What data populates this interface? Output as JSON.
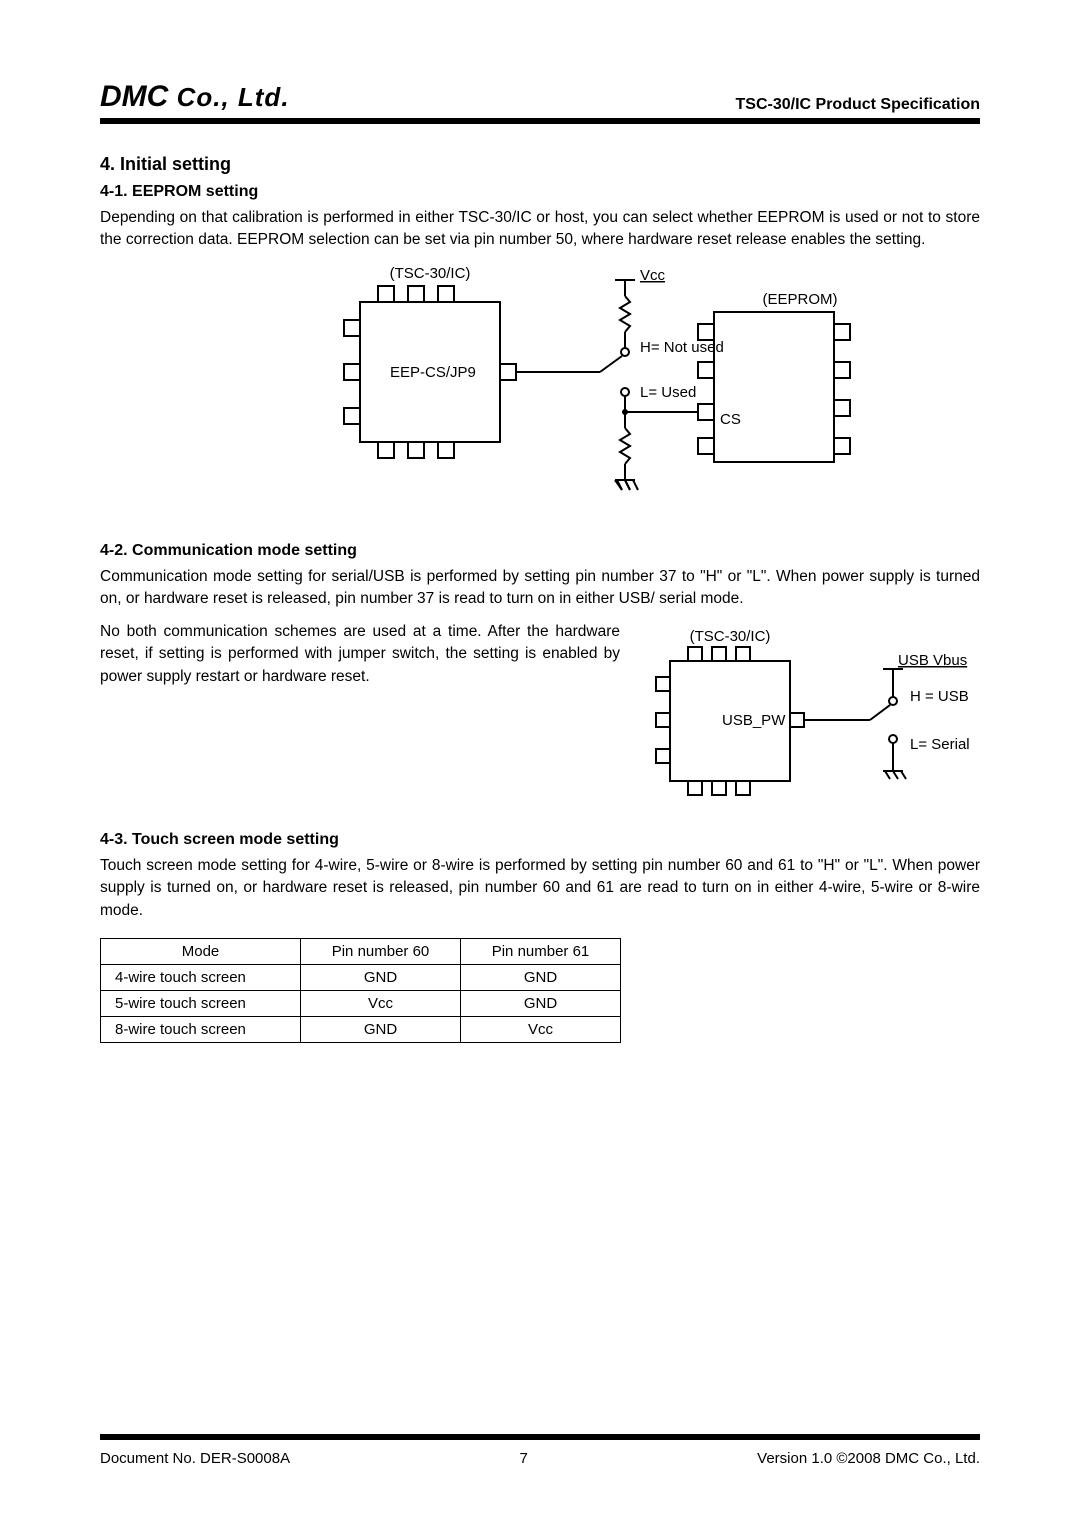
{
  "header": {
    "logo_text": "DMC Co., Ltd.",
    "doc_title": "TSC-30/IC  Product  Specification"
  },
  "section4": {
    "title": "4.  Initial  setting",
    "s41": {
      "title": "4-1.  EEPROM  setting",
      "para": "Depending on that calibration is performed in either TSC-30/IC or host, you can select whether EEPROM is used or not to store the correction data. EEPROM selection can be set via pin number 50, where hardware reset release enables the setting.",
      "diagram": {
        "chip_label": "(TSC-30/IC)",
        "eeprom_label": "(EEPROM)",
        "pin_label": "EEP-CS/JP9",
        "vcc": "Vcc",
        "h_label": "H= Not used",
        "l_label": "L= Used",
        "cs": "CS"
      }
    },
    "s42": {
      "title": "4-2.  Communication  mode  setting",
      "para1": "Communication mode setting for serial/USB is performed by setting pin number 37 to \"H\" or \"L\". When power supply is turned on, or hardware reset is released, pin number 37 is read to turn on in either USB/ serial mode.",
      "para2": "No both communication schemes are used at a time. After the hardware reset, if setting is performed with jumper switch, the setting is enabled by power supply restart or hardware reset.",
      "diagram": {
        "chip_label": "(TSC-30/IC)",
        "pin_label": "USB_PW",
        "vbus": "USB Vbus",
        "h_label": "H = USB",
        "l_label": "L= Serial"
      }
    },
    "s43": {
      "title": "4-3.  Touch  screen  mode  setting",
      "para": "Touch screen mode setting for 4-wire, 5-wire or 8-wire is performed by setting pin number 60 and 61 to \"H\" or \"L\". When power supply is turned on, or hardware reset is released, pin number 60 and 61 are read to turn on in either 4-wire, 5-wire or 8-wire mode.",
      "table": {
        "headers": [
          "Mode",
          "Pin number 60",
          "Pin number 61"
        ],
        "rows": [
          [
            "4-wire touch screen",
            "GND",
            "GND"
          ],
          [
            "5-wire touch screen",
            "Vcc",
            "GND"
          ],
          [
            "8-wire touch screen",
            "GND",
            "Vcc"
          ]
        ]
      }
    }
  },
  "footer": {
    "doc_no": "Document No.  DER-S0008A",
    "page": "7",
    "version": "Version  1.0  ©2008  DMC  Co.,  Ltd."
  }
}
